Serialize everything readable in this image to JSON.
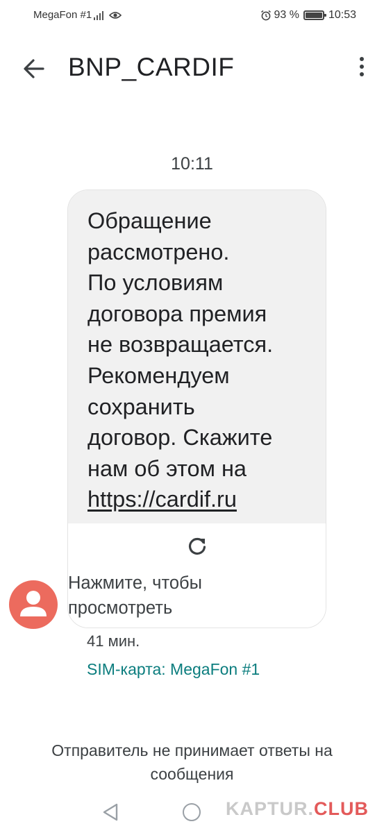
{
  "status_bar": {
    "carrier": "MegaFon #1",
    "battery": "93 %",
    "time": "10:53"
  },
  "header": {
    "title": "BNP_CARDIF"
  },
  "conversation": {
    "timestamp": "10:11",
    "message": {
      "lines": [
        "Обращение",
        "рассмотрено.",
        "По условиям",
        "договора премия",
        "не возвращается.",
        "Рекомендуем",
        "сохранить",
        "договор. Скажите",
        "нам об этом на"
      ],
      "link": "https://cardif.ru"
    },
    "preview": {
      "line1": "Нажмите, чтобы",
      "line2": "просмотреть"
    },
    "age": "41 мин.",
    "sim": "SIM-карта: MegaFon #1"
  },
  "notice": {
    "line1": "Отправитель не принимает ответы на",
    "line2": "сообщения"
  },
  "watermark": {
    "prefix": "KAPTUR.",
    "suffix": "CLUB"
  },
  "colors": {
    "avatar": "#ec6b5e",
    "sim_text": "#0b7d7e",
    "bubble": "#f1f1f1"
  }
}
